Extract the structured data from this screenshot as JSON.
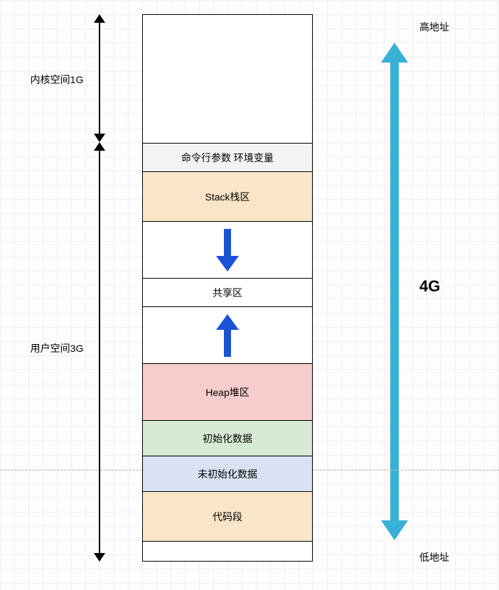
{
  "left": {
    "kernel": "内核空间1G",
    "user": "用户空间3G"
  },
  "segments": {
    "args": "命令行参数 环境变量",
    "stack": "Stack栈区",
    "shared": "共享区",
    "heap": "Heap堆区",
    "init": "初始化数据",
    "uninit": "未初始化数据",
    "code": "代码段"
  },
  "right": {
    "high": "高地址",
    "low": "低地址",
    "total": "4G"
  }
}
